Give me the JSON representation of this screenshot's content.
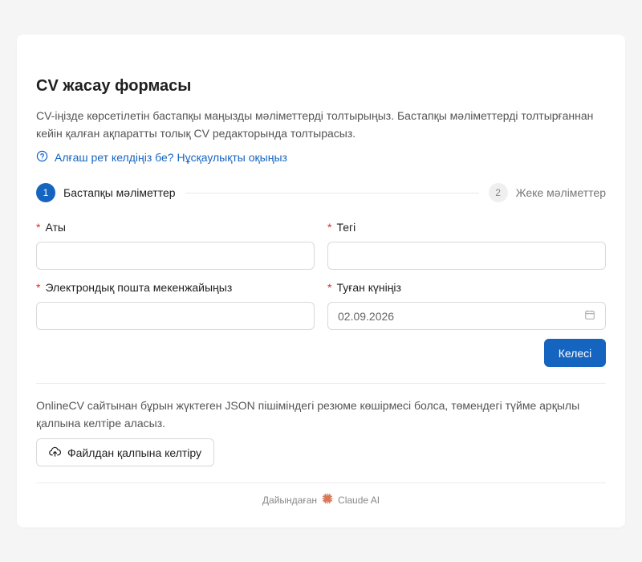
{
  "form": {
    "title": "CV жасау формасы",
    "description": "CV-іңізде көрсетілетін бастапқы маңызды мәліметтерді толтырыңыз. Бастапқы мәліметтерді толтырғаннан кейін қалған ақпаратты толық CV редакторында толтырасыз.",
    "help_link": "Алғаш рет келдіңіз бе? Нұсқаулықты оқыңыз"
  },
  "steps": [
    {
      "num": "1",
      "label": "Бастапқы мәліметтер",
      "active": true
    },
    {
      "num": "2",
      "label": "Жеке мәліметтер",
      "active": false
    }
  ],
  "fields": {
    "first_name": {
      "label": "Аты",
      "value": ""
    },
    "last_name": {
      "label": "Тегі",
      "value": ""
    },
    "email": {
      "label": "Электрондық пошта мекенжайыңыз",
      "value": ""
    },
    "birth_date": {
      "label": "Туған күніңіз",
      "value": "02.09.2026"
    },
    "required_mark": "*"
  },
  "next_button": "Келесі",
  "restore": {
    "text": "OnlineCV сайтынан бұрын жүктеген JSON пішіміндегі резюме көшірмесі болса, төмендегі түйме арқылы қалпына келтіре аласыз.",
    "button": "Файлдан қалпына келтіру"
  },
  "footer": {
    "prefix": "Дайындаған",
    "brand": "Claude AI"
  },
  "colors": {
    "accent": "#1565c0",
    "required": "#d32f2f",
    "brand_icon": "#d97757"
  },
  "icons": {
    "help": "question-circle-icon",
    "calendar": "calendar-icon",
    "upload": "cloud-upload-icon",
    "brand": "claude-spark-icon"
  }
}
